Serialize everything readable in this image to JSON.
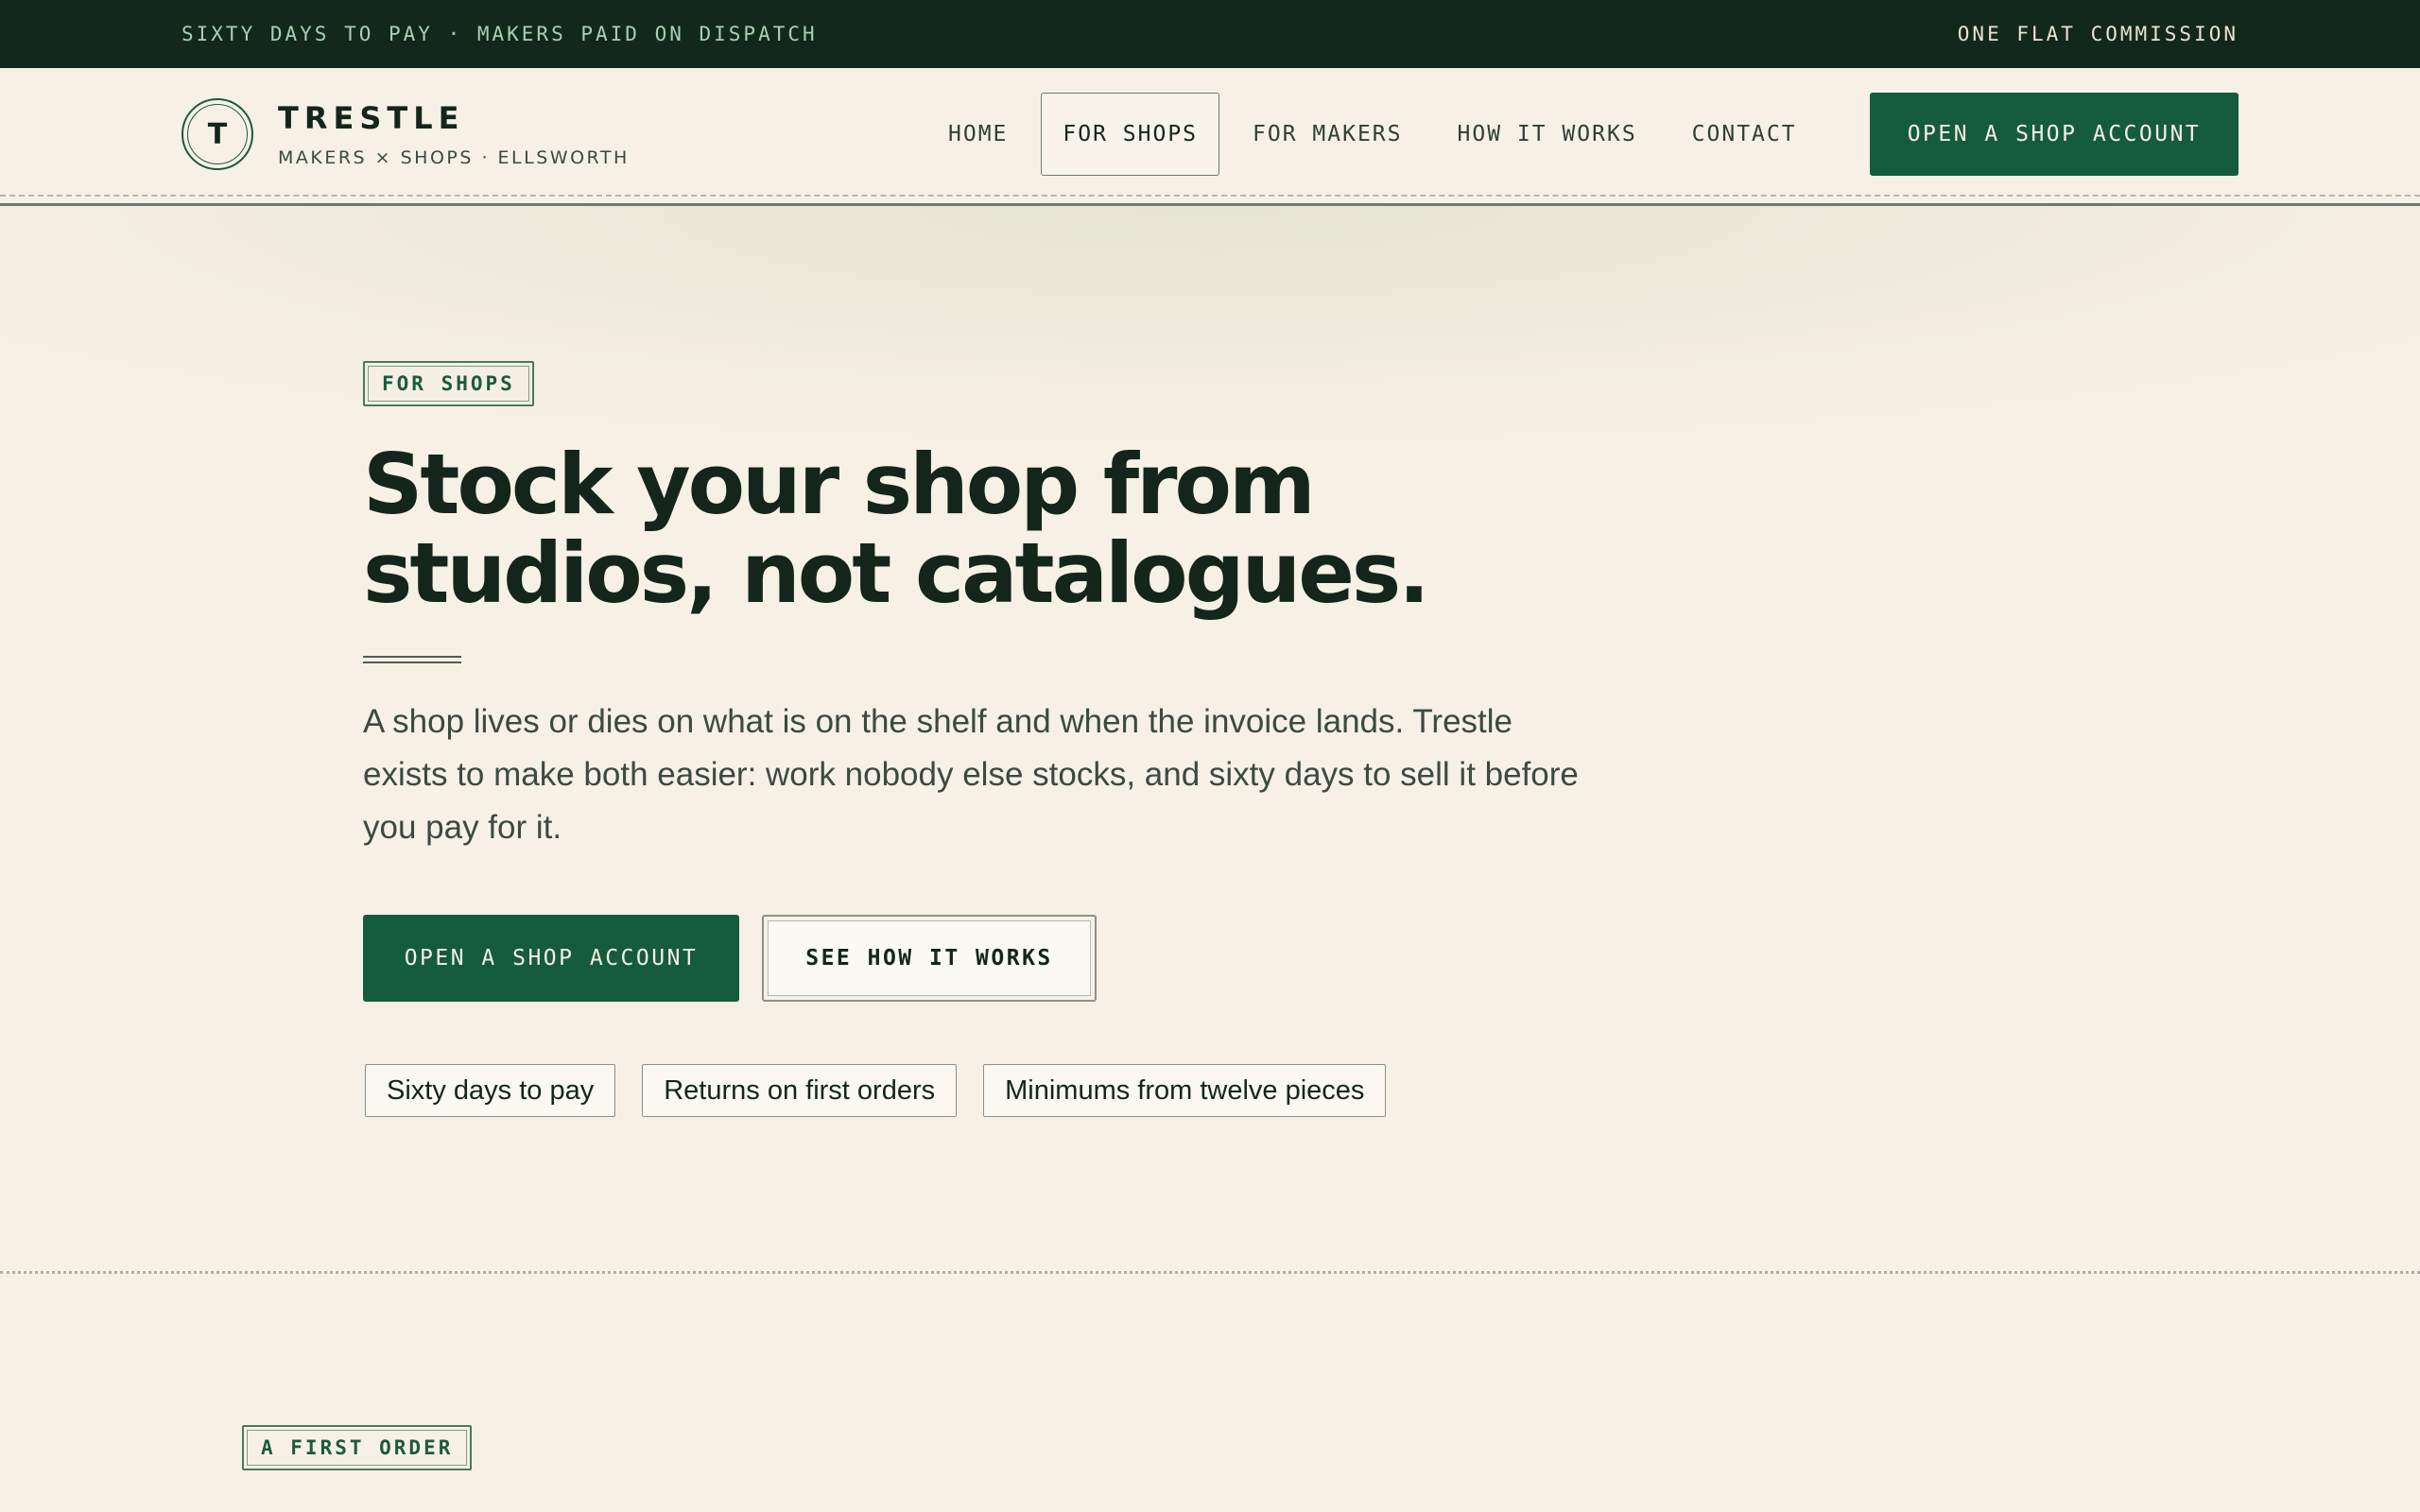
{
  "topbar": {
    "left": "SIXTY DAYS TO PAY · MAKERS PAID ON DISPATCH",
    "right": "ONE FLAT COMMISSION"
  },
  "brand": {
    "monogram": "T",
    "name": "TRESTLE",
    "tagline": "MAKERS × SHOPS · ELLSWORTH"
  },
  "nav": {
    "items": [
      {
        "label": "HOME"
      },
      {
        "label": "FOR SHOPS",
        "active": true
      },
      {
        "label": "FOR MAKERS"
      },
      {
        "label": "HOW IT WORKS"
      },
      {
        "label": "CONTACT"
      }
    ],
    "cta": "OPEN A SHOP ACCOUNT"
  },
  "hero": {
    "tag": "FOR SHOPS",
    "headline_line1": "Stock your shop from",
    "headline_line2": "studios, not catalogues.",
    "lede": "A shop lives or dies on what is on the shelf and when the invoice lands. Trestle exists to make both easier: work nobody else stocks, and sixty days to sell it before you pay for it.",
    "primary_button": "OPEN A SHOP ACCOUNT",
    "secondary_button": "SEE HOW IT WORKS",
    "chips": [
      "Sixty days to pay",
      "Returns on first orders",
      "Minimums from twelve pieces"
    ]
  },
  "next_section": {
    "tag": "A FIRST ORDER"
  },
  "colors": {
    "topbar_bg": "#13281d",
    "page_bg": "#f7f1e5",
    "accent_green": "#155c3c",
    "ink": "#14261b"
  }
}
